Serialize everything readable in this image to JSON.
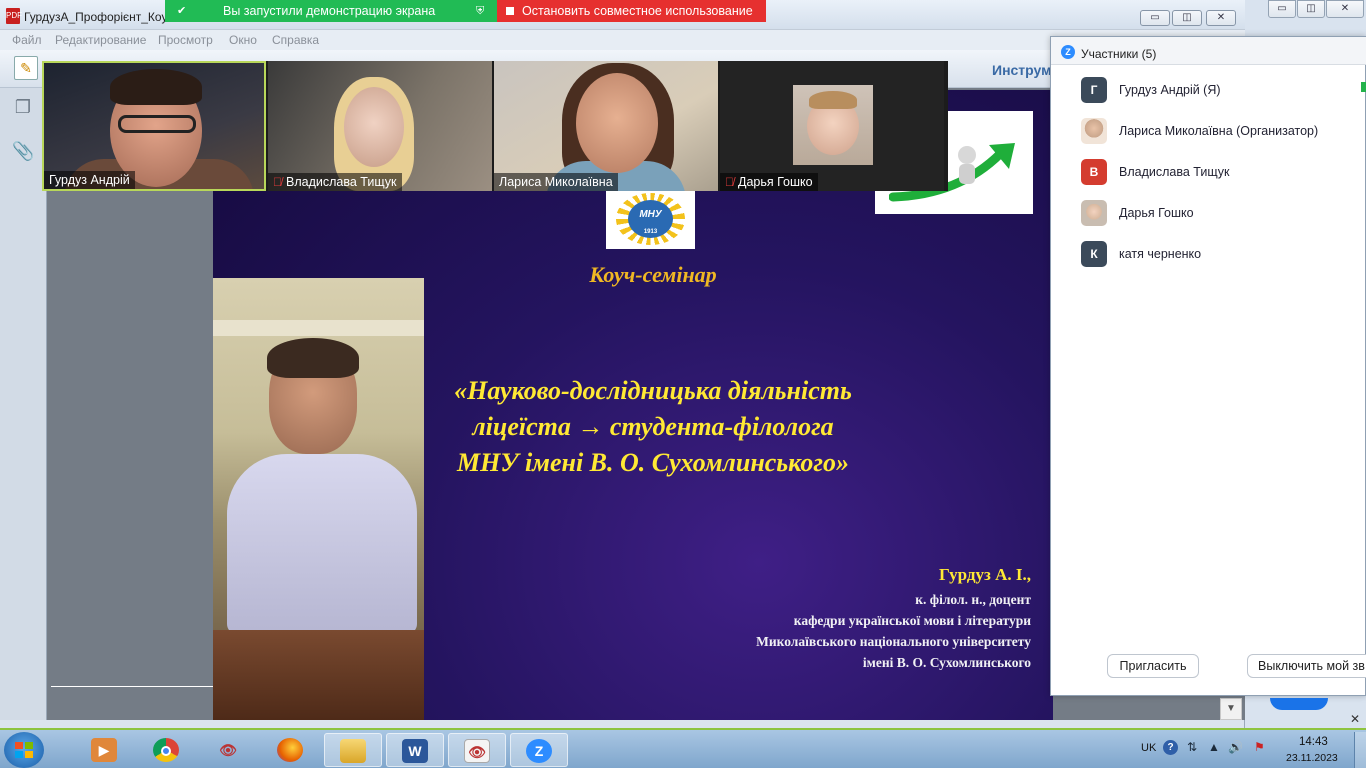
{
  "acrobat": {
    "title": "ГурдузА_Профорієнт_Коу",
    "menu": [
      "Файл",
      "Редактирование",
      "Просмотр",
      "Окно",
      "Справка"
    ],
    "tools_label": "Инструм",
    "pdf_icon": "pdf-icon"
  },
  "zoom_banner": {
    "share_text": "Вы запустили демонстрацию экрана",
    "stop_text": "Остановить совместное использование",
    "share_color": "#21bb55",
    "stop_color": "#e6302f"
  },
  "video_tiles": [
    {
      "name": "Гурдуз Андрій",
      "muted": false,
      "active_speaker": true
    },
    {
      "name": "Владислава Тищук",
      "muted": true,
      "active_speaker": false
    },
    {
      "name": "Лариса Миколаївна",
      "muted": false,
      "active_speaker": false
    },
    {
      "name": "Дарья Гошко",
      "muted": true,
      "active_speaker": false
    }
  ],
  "slide": {
    "logo_text": "МНУ",
    "logo_year": "1913",
    "subtitle": "Коуч-семінар",
    "title_lines": [
      "«Науково-дослідницька діяльність",
      "ліцеїста → студента-філолога",
      "МНУ імені В. О. Сухомлинського»"
    ],
    "author": "Гурдуз А. І.,",
    "author_info": [
      "к. філол. н., доцент",
      "кафедри української мови і літератури",
      "Миколаївського національного університету",
      "імені В. О. Сухомлинського"
    ]
  },
  "participants": {
    "title": "Участники (5)",
    "list": [
      {
        "name": "Гурдуз Андрій (Я)",
        "initial": "Г",
        "avatar_color": "#3b4a5a"
      },
      {
        "name": "Лариса Миколаївна (Организатор)",
        "initial": "",
        "avatar_color": "#caa68c"
      },
      {
        "name": "Владислава Тищук",
        "initial": "В",
        "avatar_color": "#d43c2f"
      },
      {
        "name": "Дарья Гошко",
        "initial": "",
        "avatar_color": "#d9b9a0"
      },
      {
        "name": "катя черненко",
        "initial": "К",
        "avatar_color": "#3b4a5a"
      }
    ],
    "invite_label": "Пригласить",
    "mute_all_label": "Выключить мой зв"
  },
  "taskbar": {
    "apps": [
      "media-player-icon",
      "chrome-icon",
      "eye-viewer-icon",
      "firefox-icon",
      "file-explorer-icon",
      "word-icon",
      "document-viewer-icon",
      "zoom-icon"
    ],
    "language": "UK",
    "time": "14:43",
    "date": "23.11.2023"
  }
}
